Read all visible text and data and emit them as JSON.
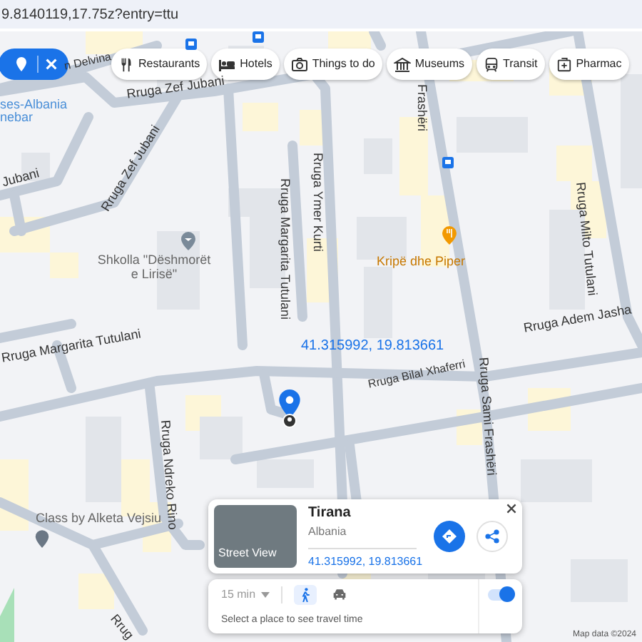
{
  "address_bar": {
    "url": "9.8140119,17.75z?entry=ttu"
  },
  "pin_filter": {
    "selected": true
  },
  "chips": [
    {
      "kind": "restaurant",
      "label": "Restaurants"
    },
    {
      "kind": "hotel",
      "label": "Hotels"
    },
    {
      "kind": "camera",
      "label": "Things to do"
    },
    {
      "kind": "museum",
      "label": "Museums"
    },
    {
      "kind": "transit",
      "label": "Transit"
    },
    {
      "kind": "pharmacy",
      "label": "Pharmac"
    }
  ],
  "map_labels": [
    {
      "kind": "street",
      "text": "n Delvina"
    },
    {
      "kind": "area",
      "text": "ses-Albania"
    },
    {
      "kind": "area",
      "text": "nebar"
    },
    {
      "kind": "street",
      "text": "Rruga Zef Jubani"
    },
    {
      "kind": "street",
      "text": "Jubani"
    },
    {
      "kind": "street",
      "text": "Rruga Zef Jubani"
    },
    {
      "kind": "street",
      "text": "Rruga Ymer Kurti"
    },
    {
      "kind": "street",
      "text": "Frashëri"
    },
    {
      "kind": "street",
      "text": "Rruga Milto Tutulani"
    },
    {
      "kind": "street",
      "text": "Rruga Margarita Tutulani"
    },
    {
      "kind": "place",
      "text": "Shkolla \"Dëshmorët e Lirisë\""
    },
    {
      "kind": "restaurant",
      "text": "Kripë dhe Piper"
    },
    {
      "kind": "street",
      "text": "Rruga Margarita Tutulani"
    },
    {
      "kind": "street",
      "text": "Rruga Adem Jasha"
    },
    {
      "kind": "street",
      "text": "Rruga Bilal Xhaferri"
    },
    {
      "kind": "street",
      "text": "Rruga Sami Frashëri"
    },
    {
      "kind": "street",
      "text": "Rruga Ndreko Rino"
    },
    {
      "kind": "place",
      "text": "Class by Alketa Vejsiu"
    },
    {
      "kind": "street",
      "text": "Rrug"
    },
    {
      "kind": "coordinates",
      "text": "41.315992, 19.813661"
    }
  ],
  "place_card": {
    "photo_label": "Street View",
    "title": "Tirana",
    "subtitle": "Albania",
    "coordinates": "41.315992, 19.813661"
  },
  "travel_time": {
    "duration": "15 min",
    "modes": [
      {
        "kind": "walk",
        "selected": true
      },
      {
        "kind": "car",
        "selected": false
      }
    ],
    "on": true,
    "hint": "Select a place to see travel time"
  },
  "attribution": "Map data ©2024"
}
